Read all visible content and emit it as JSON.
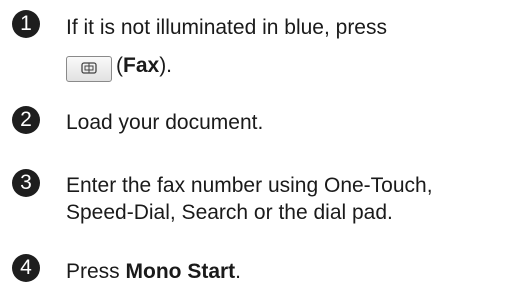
{
  "steps": [
    {
      "number": "1",
      "lines": [
        "If it is not illuminated in blue, press"
      ],
      "button": {
        "icon": "fax-icon",
        "open_paren": "(",
        "label": "Fax",
        "close_paren": ")."
      }
    },
    {
      "number": "2",
      "lines": [
        "Load your document."
      ]
    },
    {
      "number": "3",
      "lines": [
        "Enter the fax number using One-Touch,",
        "Speed-Dial, Search or the dial pad."
      ]
    },
    {
      "number": "4",
      "prefix": "Press ",
      "bold": "Mono Start",
      "suffix": "."
    }
  ],
  "colors": {
    "bullet_bg": "#1e1e1e",
    "text": "#1a1a1a"
  }
}
